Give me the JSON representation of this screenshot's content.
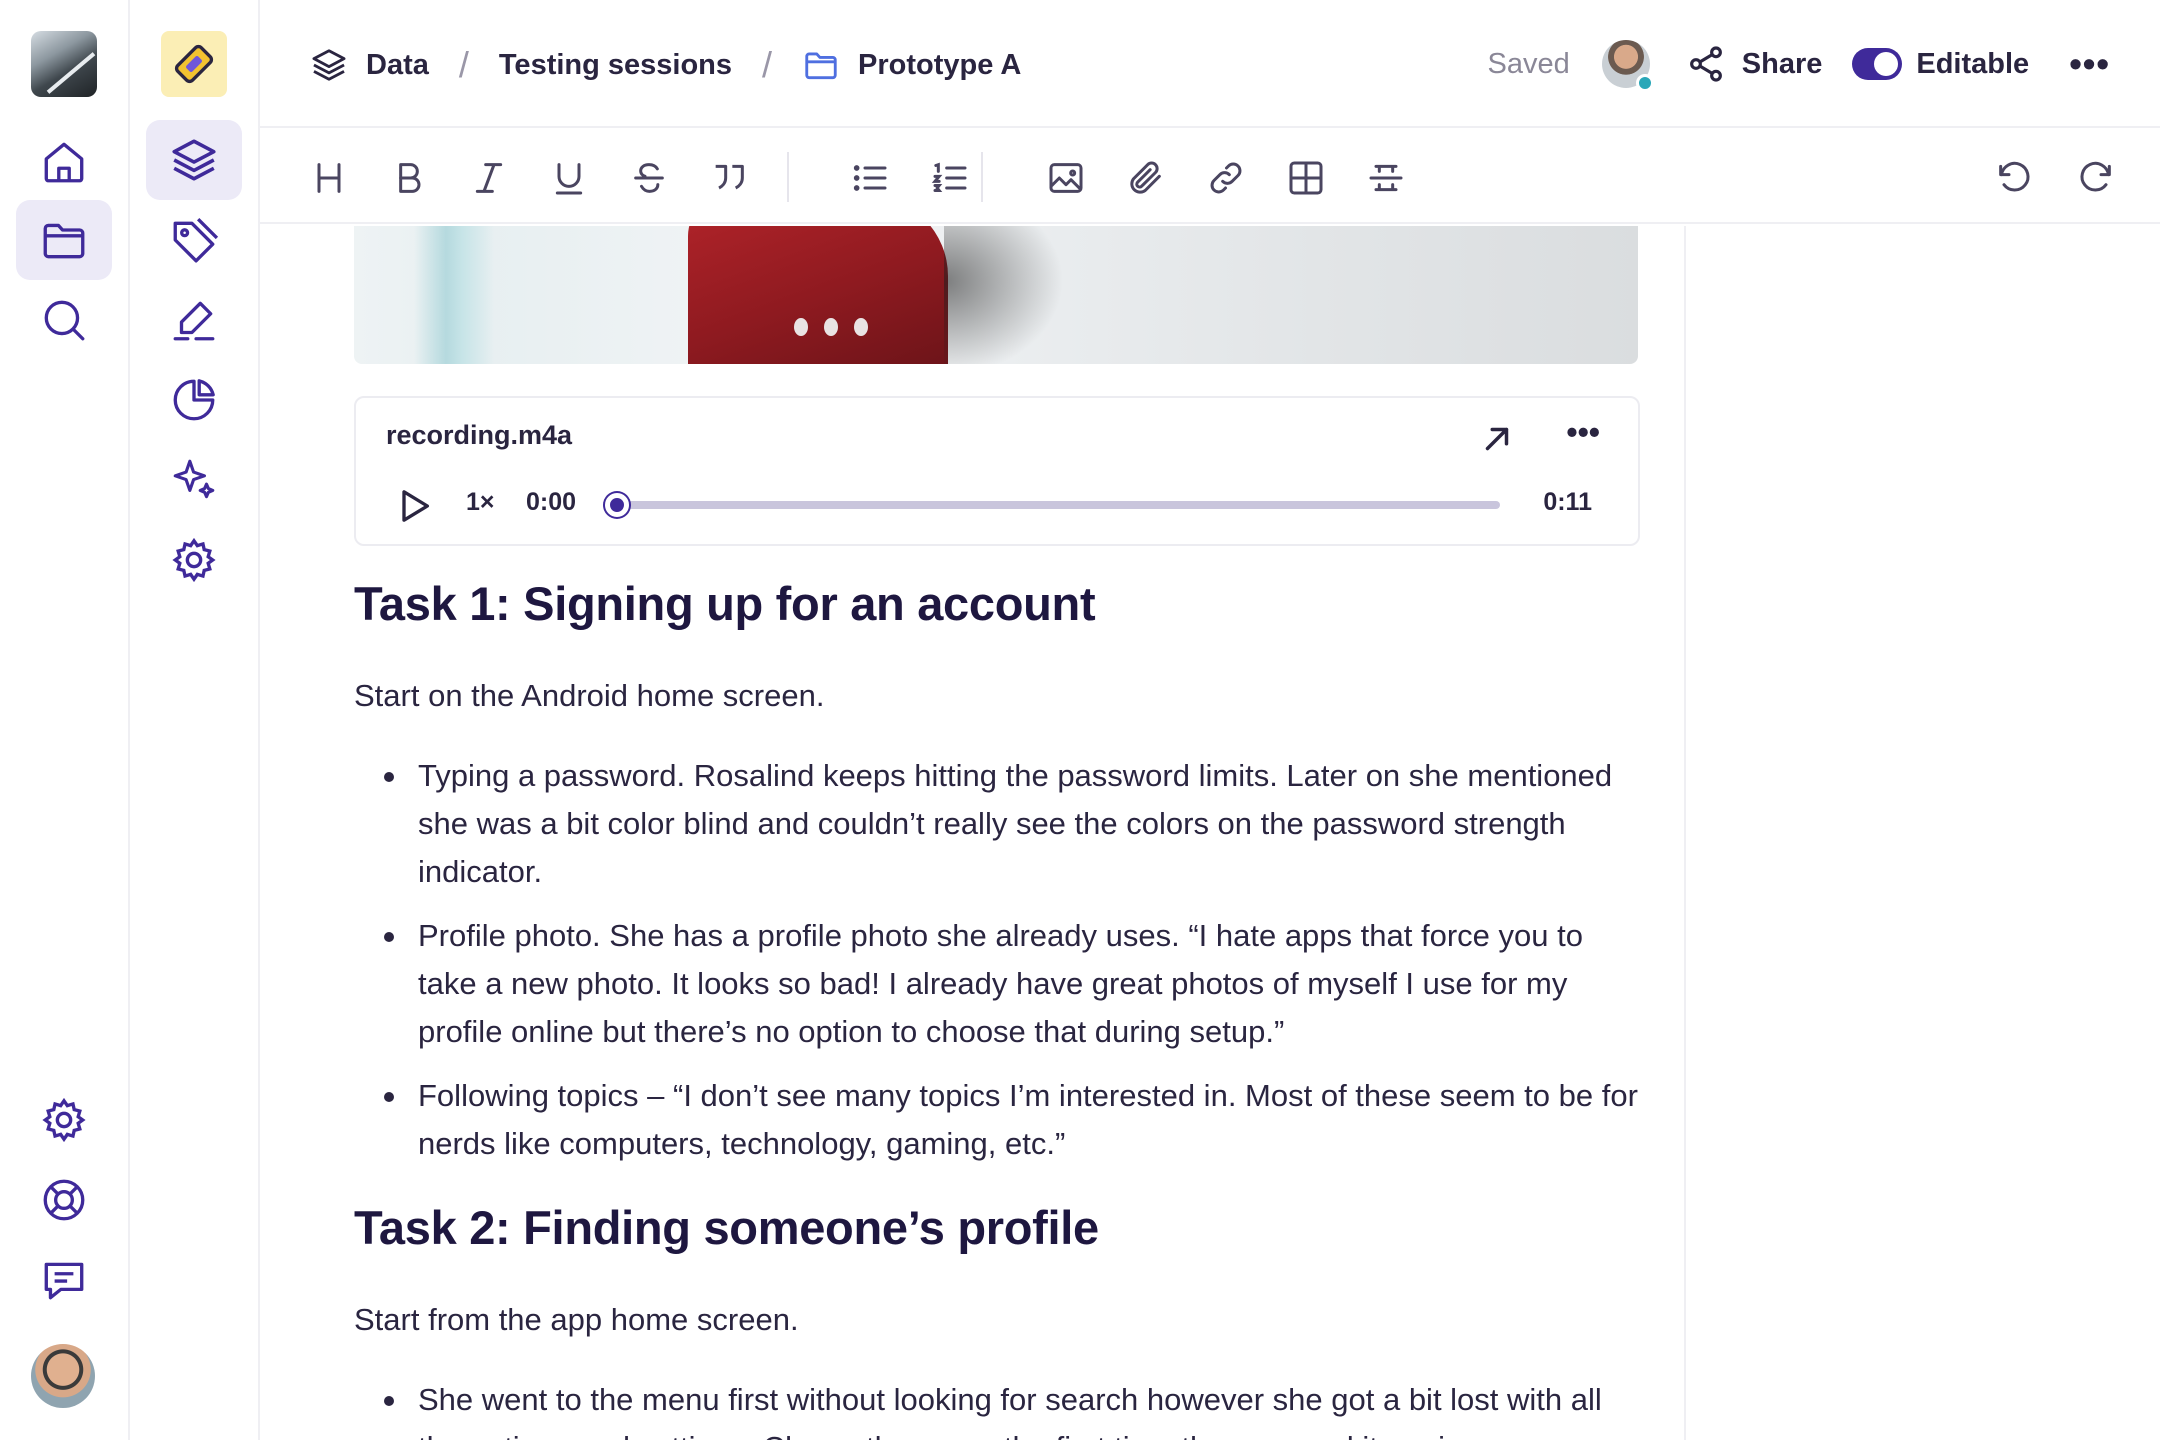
{
  "breadcrumbs": [
    {
      "label": "Data",
      "icon": "layers-icon"
    },
    {
      "label": "Testing sessions"
    },
    {
      "label": "Prototype A",
      "icon": "folder-icon"
    }
  ],
  "breadcrumb_separator": "/",
  "header": {
    "status": "Saved",
    "share_label": "Share",
    "editable_label": "Editable",
    "editable_on": true,
    "more_label": "•••"
  },
  "audio": {
    "file_name": "recording.m4a",
    "speed": "1×",
    "current_time": "0:00",
    "duration": "0:11",
    "progress": 0,
    "more_label": "•••"
  },
  "document": {
    "task1": {
      "heading": "Task 1: Signing up for an account",
      "intro": "Start on the Android home screen.",
      "bullets": [
        "Typing a password. Rosalind keeps hitting the password limits. Later on she mentioned she was a bit color blind and couldn’t really see the colors on the password strength indicator.",
        "Profile photo. She has a profile photo she already uses. “I hate apps that force you to take a new photo. It looks so bad! I already have great photos of myself I use for my profile online but there’s no option to choose that during setup.”",
        "Following topics – “I don’t see many topics I’m interested in. Most of these seem to be for nerds like computers, technology, gaming, etc.”"
      ]
    },
    "task2": {
      "heading": "Task 2: Finding someone’s profile",
      "intro": "Start from the app home screen.",
      "bullets": [
        "She went to the menu first without looking for search however she got a bit lost with all the options and settings. Closes the menu the first time then opened it again a"
      ]
    }
  },
  "colors": {
    "accent": "#3f2a9a",
    "active_bg": "#eceaf7",
    "text": "#2a2540",
    "muted": "#8a8797",
    "project_logo_bg": "#fbeeb5",
    "presence_dot": "#2aa7b8"
  }
}
